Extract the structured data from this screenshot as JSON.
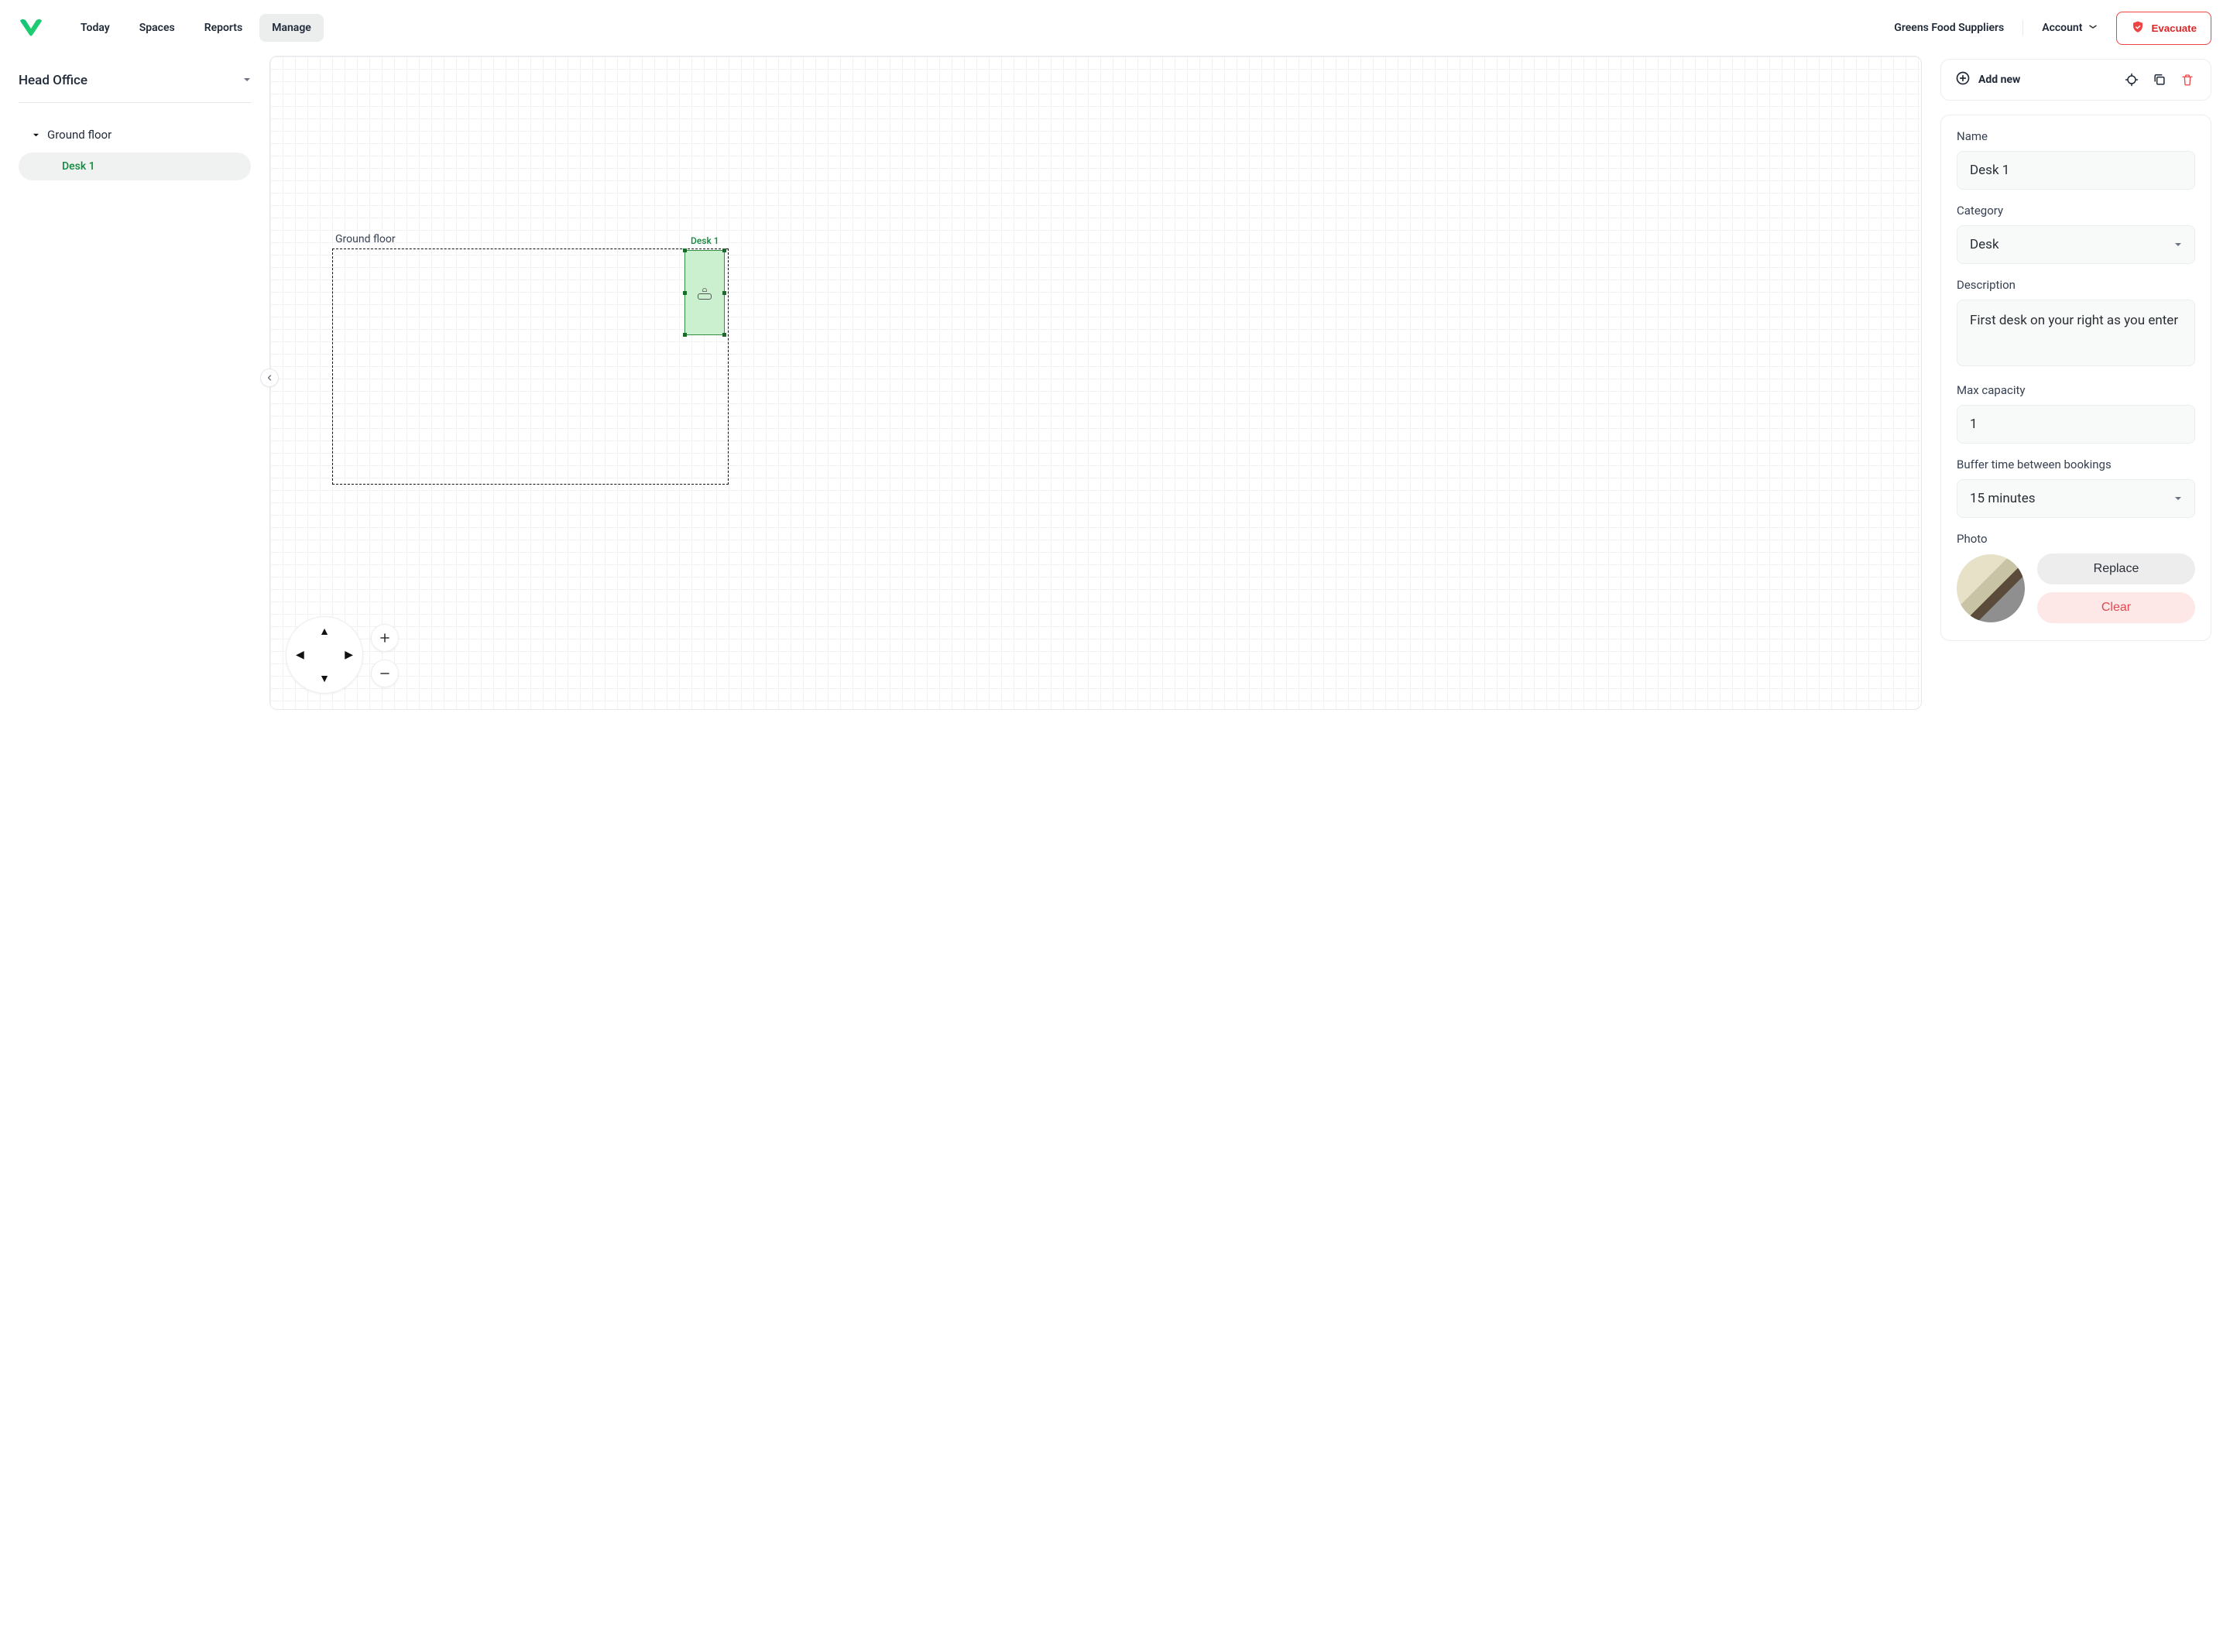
{
  "header": {
    "nav": {
      "today": "Today",
      "spaces": "Spaces",
      "reports": "Reports",
      "manage": "Manage",
      "active": "manage"
    },
    "org_name": "Greens Food Suppliers",
    "account_label": "Account",
    "evacuate_label": "Evacuate"
  },
  "sidebar": {
    "location": "Head Office",
    "tree": {
      "node_label": "Ground floor",
      "leaf_label": "Desk 1"
    }
  },
  "canvas": {
    "floor_label": "Ground floor",
    "desk_label": "Desk 1"
  },
  "toolbar": {
    "add_new_label": "Add new"
  },
  "properties": {
    "name_label": "Name",
    "name_value": "Desk 1",
    "category_label": "Category",
    "category_value": "Desk",
    "description_label": "Description",
    "description_value": "First desk on your right as you enter",
    "max_capacity_label": "Max capacity",
    "max_capacity_value": "1",
    "buffer_label": "Buffer time between bookings",
    "buffer_value": "15 minutes",
    "photo_label": "Photo",
    "replace_label": "Replace",
    "clear_label": "Clear"
  },
  "colors": {
    "accent_green": "#22c55e",
    "danger_red": "#ef4444"
  }
}
